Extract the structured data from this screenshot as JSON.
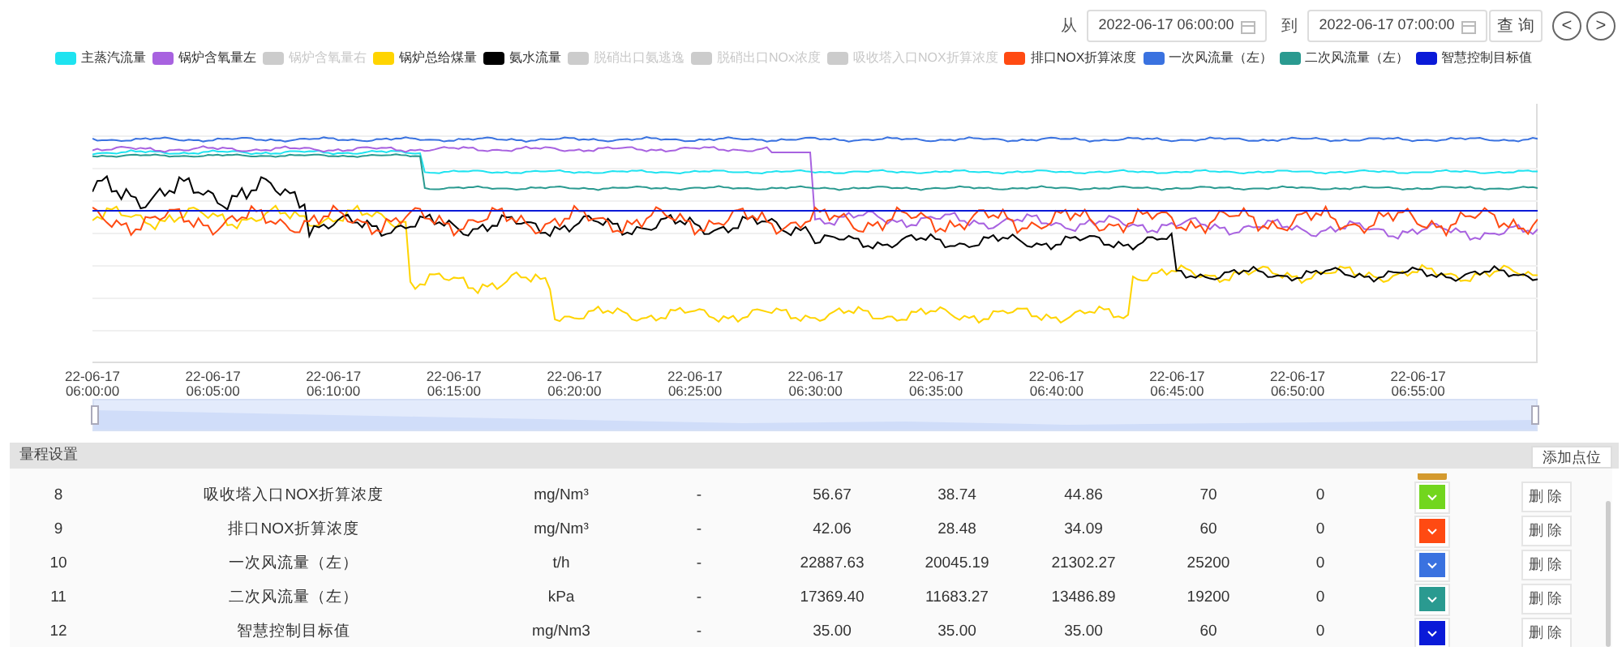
{
  "query_bar": {
    "from_label": "从",
    "from_value": "2022-06-17 06:00:00",
    "to_label": "到",
    "to_value": "2022-06-17 07:00:00",
    "query_button": "查 询",
    "prev_button": "<",
    "next_button": ">"
  },
  "legend": [
    {
      "label": "主蒸汽流量",
      "on": true,
      "color": "#1ee3f0"
    },
    {
      "label": "锅炉含氧量左",
      "on": true,
      "color": "#a862e0"
    },
    {
      "label": "锅炉含氧量右",
      "on": false
    },
    {
      "label": "锅炉总给煤量",
      "on": true,
      "color": "#ffd400"
    },
    {
      "label": "氨水流量",
      "on": true,
      "color": "#000000"
    },
    {
      "label": "脱硝出口氨逃逸",
      "on": false
    },
    {
      "label": "脱硝出口NOx浓度",
      "on": false
    },
    {
      "label": "吸收塔入口NOX折算浓度",
      "on": false
    },
    {
      "label": "排口NOX折算浓度",
      "on": true,
      "color": "#ff4a12"
    },
    {
      "label": "一次风流量（左）",
      "on": true,
      "color": "#3a72e0"
    },
    {
      "label": "二次风流量（左）",
      "on": true,
      "color": "#2a9a90"
    },
    {
      "label": "智慧控制目标值",
      "on": true,
      "color": "#0a1ad8"
    }
  ],
  "x_axis_labels": [
    [
      "22-06-17",
      "06:00:00"
    ],
    [
      "22-06-17",
      "06:05:00"
    ],
    [
      "22-06-17",
      "06:10:00"
    ],
    [
      "22-06-17",
      "06:15:00"
    ],
    [
      "22-06-17",
      "06:20:00"
    ],
    [
      "22-06-17",
      "06:25:00"
    ],
    [
      "22-06-17",
      "06:30:00"
    ],
    [
      "22-06-17",
      "06:35:00"
    ],
    [
      "22-06-17",
      "06:40:00"
    ],
    [
      "22-06-17",
      "06:45:00"
    ],
    [
      "22-06-17",
      "06:50:00"
    ],
    [
      "22-06-17",
      "06:55:00"
    ]
  ],
  "time_range_slider": {
    "level": 1
  },
  "range_settings": {
    "title": "量程设置",
    "add_button": "添加点位",
    "partial_row": {
      "color": "#d49a2e"
    },
    "rows": [
      {
        "index": "8",
        "name": "吸收塔入口NOX折算浓度",
        "unit": "mg/Nm³",
        "column_4": "-",
        "column_5": "56.67",
        "column_6": "38.74",
        "column_7": "44.86",
        "column_8": "70",
        "column_9": "0",
        "color": "#72d61e",
        "delete_button": "删 除"
      },
      {
        "index": "9",
        "name": "排口NOX折算浓度",
        "unit": "mg/Nm³",
        "column_4": "-",
        "column_5": "42.06",
        "column_6": "28.48",
        "column_7": "34.09",
        "column_8": "60",
        "column_9": "0",
        "color": "#ff4a12",
        "delete_button": "删 除"
      },
      {
        "index": "10",
        "name": "一次风流量（左）",
        "unit": "t/h",
        "column_4": "-",
        "column_5": "22887.63",
        "column_6": "20045.19",
        "column_7": "21302.27",
        "column_8": "25200",
        "column_9": "0",
        "color": "#3a72e0",
        "delete_button": "删 除"
      },
      {
        "index": "11",
        "name": "二次风流量（左）",
        "unit": "kPa",
        "column_4": "-",
        "column_5": "17369.40",
        "column_6": "11683.27",
        "column_7": "13486.89",
        "column_8": "19200",
        "column_9": "0",
        "color": "#2a9a90",
        "delete_button": "删 除"
      },
      {
        "index": "12",
        "name": "智慧控制目标值",
        "unit": "mg/Nm3",
        "column_4": "-",
        "column_5": "35.00",
        "column_6": "35.00",
        "column_7": "35.00",
        "column_8": "60",
        "column_9": "0",
        "color": "#0a1ad8",
        "delete_button": "删 除"
      }
    ]
  }
}
